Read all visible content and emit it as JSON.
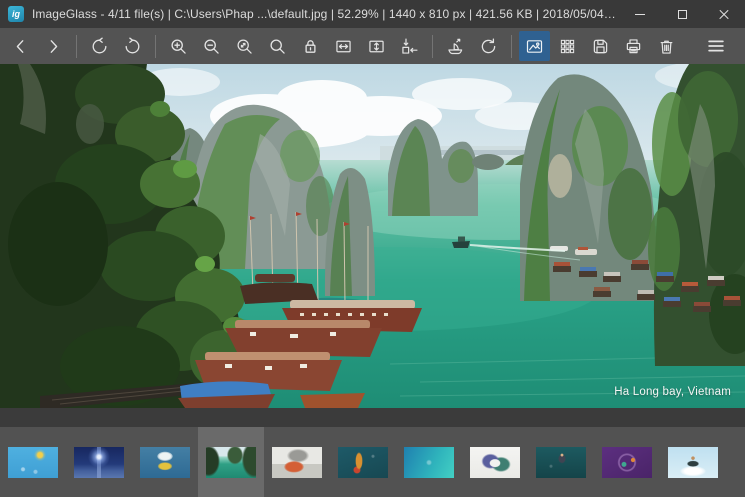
{
  "window": {
    "app_icon_text": "ig",
    "title": "ImageGlass - 4/11 file(s)  |  C:\\Users\\Phap ...\\default.jpg  |  52.29%  |  1440 x 810 px  |  421.56 KB  |  2018/05/04 0...",
    "controls": [
      "minimize",
      "maximize",
      "close"
    ]
  },
  "status": {
    "app": "ImageGlass",
    "position": "4/11 file(s)",
    "path": "C:\\Users\\Phap ...\\default.jpg",
    "zoom": "52.29%",
    "dimensions": "1440 x 810 px",
    "file_size": "421.56 KB",
    "modified": "2018/05/04 0..."
  },
  "toolbar": {
    "items": [
      {
        "name": "previous-image",
        "icon": "chevron-left-icon",
        "active": false
      },
      {
        "name": "next-image",
        "icon": "chevron-right-icon",
        "active": false
      },
      {
        "name": "rotate-left",
        "icon": "rotate-ccw-icon",
        "active": false
      },
      {
        "name": "rotate-right",
        "icon": "rotate-cw-icon",
        "active": false
      },
      {
        "name": "zoom-in",
        "icon": "magnifier-plus-icon",
        "active": false
      },
      {
        "name": "zoom-out",
        "icon": "magnifier-minus-icon",
        "active": false
      },
      {
        "name": "scale-to-fit",
        "icon": "magnifier-arrows-icon",
        "active": false
      },
      {
        "name": "actual-size",
        "icon": "magnifier-icon",
        "active": false
      },
      {
        "name": "lock-zoom-ratio",
        "icon": "lock-icon",
        "active": false
      },
      {
        "name": "scale-to-width",
        "icon": "box-horizontal-arrow-icon",
        "active": false
      },
      {
        "name": "scale-to-height",
        "icon": "box-vertical-arrow-icon",
        "active": false
      },
      {
        "name": "auto-resize-window",
        "icon": "shrink-to-box-icon",
        "active": false
      },
      {
        "name": "open-file",
        "icon": "boat-icon",
        "active": false
      },
      {
        "name": "refresh",
        "icon": "refresh-icon",
        "active": false
      },
      {
        "name": "thumbnail-bar-toggle",
        "icon": "picture-icon",
        "active": true
      },
      {
        "name": "checkerboard-toggle",
        "icon": "grid-icon",
        "active": false
      },
      {
        "name": "save",
        "icon": "floppy-icon",
        "active": false
      },
      {
        "name": "print",
        "icon": "printer-icon",
        "active": false
      },
      {
        "name": "delete",
        "icon": "trash-icon",
        "active": false
      },
      {
        "name": "main-menu",
        "icon": "hamburger-icon",
        "active": false
      }
    ],
    "active_color": "#2f6191"
  },
  "image": {
    "caption": "Ha Long bay, Vietnam"
  },
  "thumbnails": {
    "selected_index": 4,
    "items": [
      {
        "desc": "cartoon sunny beach, blue sky with sun",
        "selected": false
      },
      {
        "desc": "cartoon lighthouse at night, dark blue",
        "selected": false
      },
      {
        "desc": "cartoon yellow submarine on teal",
        "selected": false
      },
      {
        "desc": "Ha Long bay photo (current image)",
        "selected": true
      },
      {
        "desc": "grayscale scene with red van",
        "selected": false
      },
      {
        "desc": "guitar on dark teal background",
        "selected": false
      },
      {
        "desc": "teal-cyan gradient",
        "selected": false
      },
      {
        "desc": "illustration with blue-green blob on white",
        "selected": false
      },
      {
        "desc": "astronaut figure on dark teal",
        "selected": false
      },
      {
        "desc": "purple space illustration with planets",
        "selected": false
      },
      {
        "desc": "bear on inner tube in clouds",
        "selected": false
      }
    ]
  },
  "colors": {
    "titlebar_bg": "#393939",
    "toolbar_bg": "#535353",
    "viewport_bg": "#3b3b3b",
    "thumbbar_bg": "#525252",
    "selected_thumb_bg": "#6a6a6a",
    "accent_active": "#2f6191",
    "icon_stroke": "#e3e3e3",
    "app_icon_teal": "#2fa3c6"
  }
}
